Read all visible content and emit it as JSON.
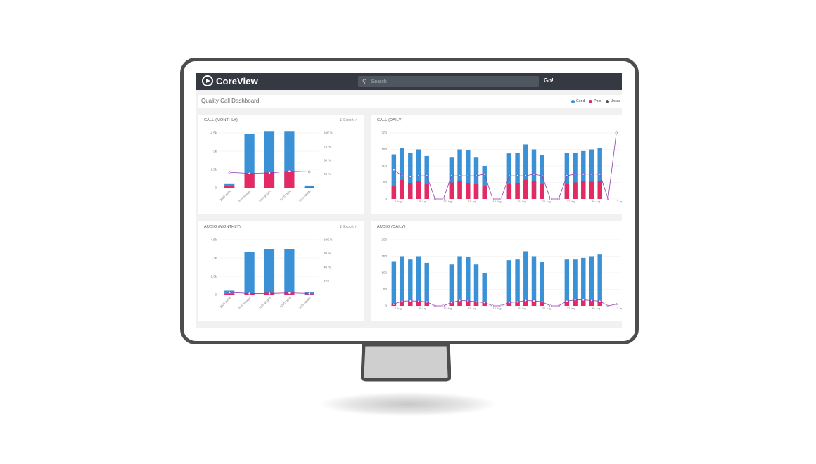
{
  "app": {
    "brand": "CoreView",
    "go_label": "Go!",
    "search_placeholder": "Search"
  },
  "dashboard": {
    "title": "Quality Call Dashboard",
    "legend": [
      {
        "label": "Good",
        "color": "#3a91d6"
      },
      {
        "label": "Poor",
        "color": "#e42a63"
      },
      {
        "label": "Uncas",
        "color": "#555555"
      }
    ]
  },
  "colors": {
    "good": "#3a91d6",
    "poor": "#e42a63",
    "line": "#8e3aad"
  },
  "panels": {
    "call_monthly": {
      "title": "CALL (MONTHLY)",
      "export_label": "Export"
    },
    "call_daily": {
      "title": "CALL (DAILY)"
    },
    "audio_monthly": {
      "title": "AUDIO (MONTHLY)",
      "export_label": "Export"
    },
    "audio_daily": {
      "title": "AUDIO (DAILY)"
    }
  },
  "chart_data": [
    {
      "type": "bar",
      "panel": "call_monthly",
      "categories": [
        "2020 aprile",
        "2020 maggio",
        "2020 giugno",
        "2020 luglio",
        "2020 agosto"
      ],
      "series": [
        {
          "name": "Good",
          "values": [
            300,
            4400,
            4600,
            4600,
            180
          ]
        },
        {
          "name": "Poor",
          "values": [
            150,
            1150,
            1250,
            1350,
            40
          ]
        },
        {
          "name": "Poor %",
          "values": [
            28,
            26,
            27,
            30,
            29
          ]
        }
      ],
      "y_ticks": [
        "0",
        "1.5k",
        "3k",
        "4.5k"
      ],
      "ylim": [
        0,
        4500
      ],
      "y2_ticks": [
        "25 %",
        "50 %",
        "75 %",
        "100 %"
      ],
      "y2lim": [
        0,
        100
      ]
    },
    {
      "type": "bar",
      "panel": "audio_monthly",
      "categories": [
        "2020 aprile",
        "2020 maggio",
        "2020 giugno",
        "2020 luglio",
        "2020 agosto"
      ],
      "series": [
        {
          "name": "Good",
          "values": [
            320,
            3500,
            3750,
            3750,
            200
          ]
        },
        {
          "name": "Poor",
          "values": [
            60,
            100,
            150,
            200,
            40
          ]
        },
        {
          "name": "Poor %",
          "values": [
            4,
            2,
            2,
            3,
            2
          ]
        }
      ],
      "y_ticks": [
        "0",
        "1.5k",
        "3k",
        "4.5k"
      ],
      "ylim": [
        0,
        4500
      ],
      "y2_ticks": [
        "0 %",
        "40 %",
        "80 %",
        "100 %"
      ],
      "y2lim": [
        0,
        100
      ]
    },
    {
      "type": "bar",
      "panel": "call_daily",
      "x_labels": [
        "6. lug",
        "9. lug",
        "12. lug",
        "15. lug",
        "18. lug",
        "21. lug",
        "24. lug",
        "27. lug",
        "30. lug",
        "2. ago"
      ],
      "series": [
        {
          "name": "Good",
          "values": [
            135,
            155,
            140,
            150,
            130,
            0,
            0,
            125,
            150,
            148,
            125,
            100,
            0,
            0,
            138,
            140,
            165,
            150,
            132,
            0,
            0,
            140,
            140,
            145,
            150,
            155,
            0,
            0
          ]
        },
        {
          "name": "Poor",
          "values": [
            40,
            58,
            48,
            55,
            45,
            0,
            0,
            50,
            55,
            48,
            45,
            40,
            0,
            0,
            45,
            48,
            58,
            55,
            45,
            0,
            0,
            45,
            50,
            55,
            52,
            55,
            0,
            0
          ]
        },
        {
          "name": "Poor %",
          "values": [
            88,
            70,
            68,
            70,
            70,
            0,
            0,
            70,
            70,
            70,
            70,
            75,
            0,
            0,
            70,
            70,
            70,
            75,
            70,
            0,
            0,
            70,
            75,
            75,
            75,
            75,
            0,
            200
          ]
        }
      ],
      "y_ticks": [
        "0",
        "50",
        "100",
        "150",
        "200"
      ],
      "ylim": [
        0,
        200
      ]
    },
    {
      "type": "bar",
      "panel": "audio_daily",
      "x_labels": [
        "6. lug",
        "9. lug",
        "12. lug",
        "15. lug",
        "18. lug",
        "21. lug",
        "24. lug",
        "27. lug",
        "30. lug",
        "2. ago"
      ],
      "series": [
        {
          "name": "Good",
          "values": [
            135,
            150,
            140,
            150,
            130,
            0,
            0,
            125,
            150,
            148,
            125,
            100,
            0,
            0,
            138,
            140,
            165,
            150,
            132,
            0,
            0,
            140,
            140,
            145,
            150,
            155,
            0,
            0
          ]
        },
        {
          "name": "Poor",
          "values": [
            8,
            14,
            15,
            14,
            12,
            0,
            0,
            10,
            16,
            15,
            12,
            10,
            0,
            0,
            10,
            12,
            16,
            15,
            12,
            0,
            0,
            14,
            18,
            18,
            16,
            14,
            0,
            0
          ]
        },
        {
          "name": "Poor %",
          "values": [
            5,
            14,
            15,
            14,
            12,
            0,
            0,
            10,
            16,
            15,
            12,
            10,
            0,
            0,
            10,
            12,
            16,
            15,
            12,
            0,
            0,
            14,
            18,
            18,
            16,
            14,
            0,
            5
          ]
        }
      ],
      "y_ticks": [
        "0",
        "50",
        "100",
        "150",
        "200"
      ],
      "ylim": [
        0,
        200
      ]
    }
  ]
}
